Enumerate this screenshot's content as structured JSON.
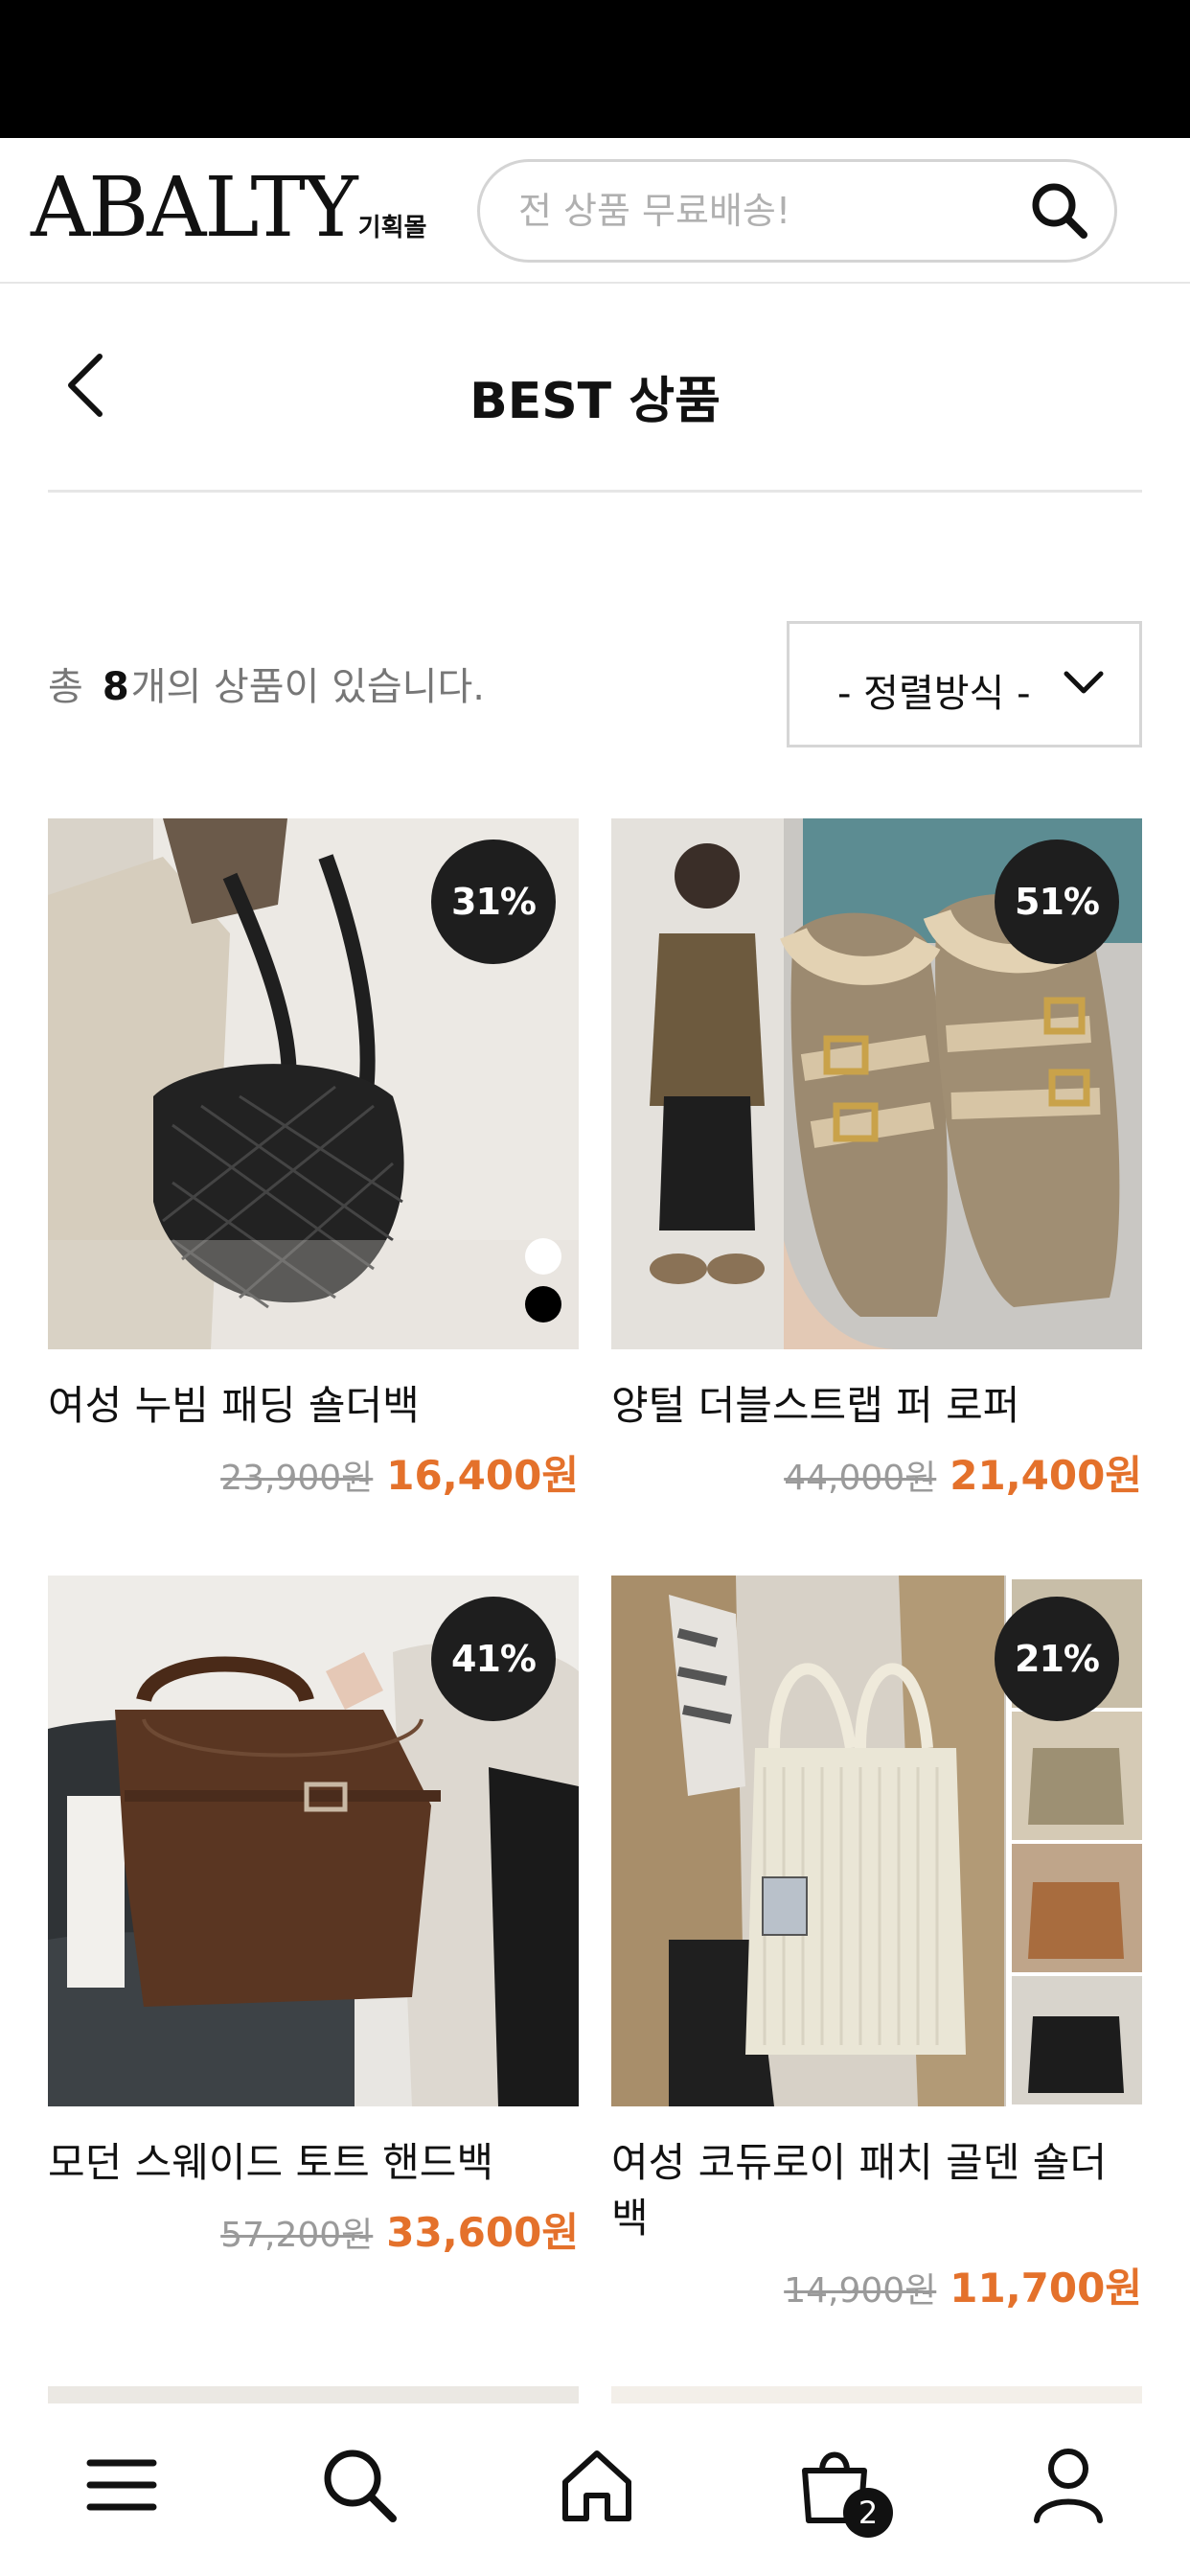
{
  "header": {
    "logo_text": "ABALTY",
    "logo_sub": "기획몰",
    "search_placeholder": "전 상품 무료배송!",
    "search_icon": "search-icon"
  },
  "page": {
    "title": "BEST 상품",
    "back_icon": "chevron-left-icon"
  },
  "listing": {
    "count_prefix": "총",
    "count": "8",
    "count_suffix": "개의 상품이 있습니다.",
    "sort_label": "- 정렬방식 -",
    "sort_icon": "chevron-down-icon"
  },
  "products": [
    {
      "name": "여성 누빔 패딩 숄더백",
      "original_price": "23,900원",
      "sale_price": "16,400원",
      "discount": "31%"
    },
    {
      "name": "양털 더블스트랩 퍼 로퍼",
      "original_price": "44,000원",
      "sale_price": "21,400원",
      "discount": "51%"
    },
    {
      "name": "모던 스웨이드 토트 핸드백",
      "original_price": "57,200원",
      "sale_price": "33,600원",
      "discount": "41%"
    },
    {
      "name": "여성 코듀로이 패치 골덴 숄더백",
      "original_price": "14,900원",
      "sale_price": "11,700원",
      "discount": "21%"
    }
  ],
  "bottom_nav": {
    "items": [
      "menu-icon",
      "search-icon",
      "home-icon",
      "cart-icon",
      "user-icon"
    ],
    "cart_count": "2"
  },
  "colors": {
    "accent": "#e4712b",
    "badge": "#1e1e1e",
    "text": "#111111",
    "muted": "#9a9a9a"
  }
}
